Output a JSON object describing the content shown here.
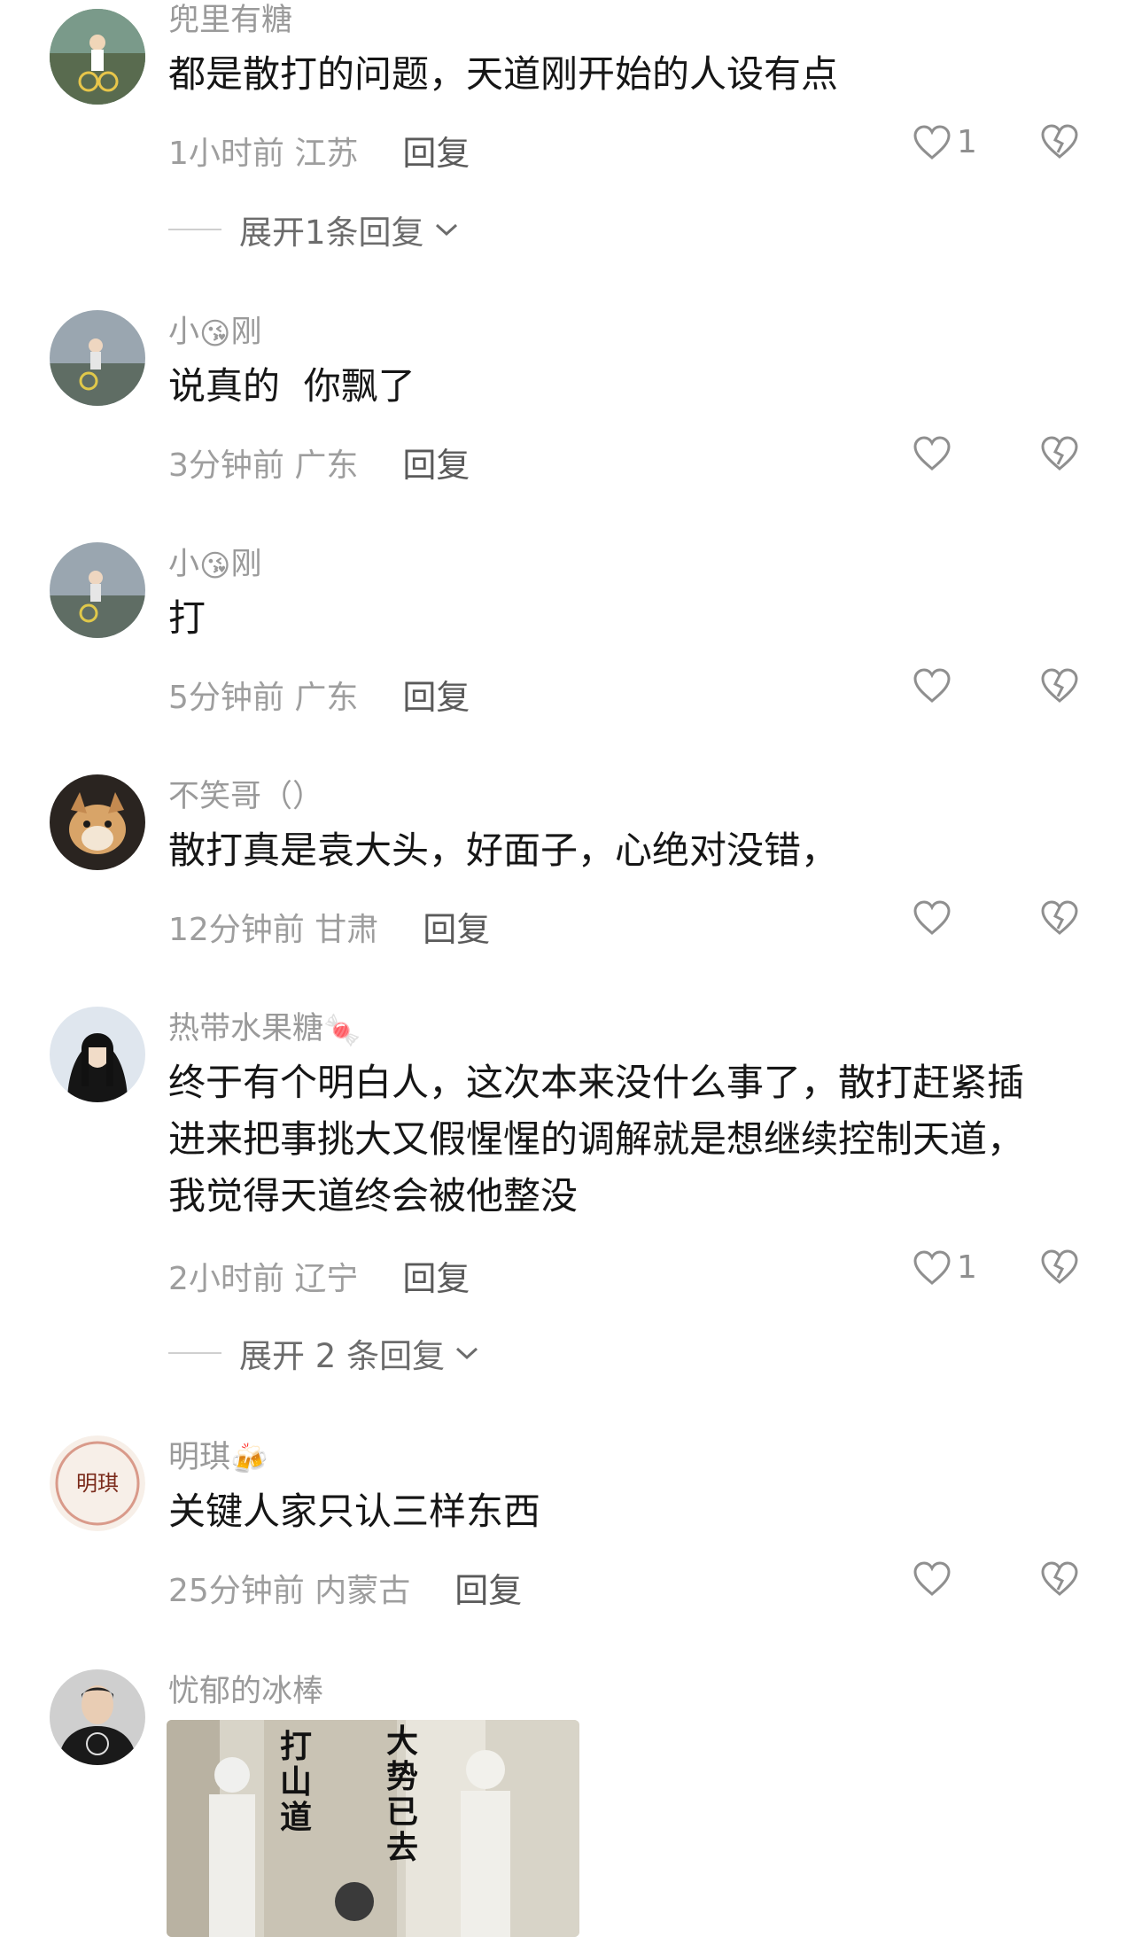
{
  "comments": [
    {
      "username": "兜里有糖",
      "text": "都是散打的问题，天道刚开始的人设有点",
      "time": "1小时前 江苏",
      "reply": "回复",
      "likes": "1",
      "expand": "展开1条回复"
    },
    {
      "username_a": "小",
      "username_b": "刚",
      "emoji": "😘",
      "text": "说真的  你飘了",
      "time": "3分钟前 广东",
      "reply": "回复",
      "likes": ""
    },
    {
      "username_a": "小",
      "username_b": "刚",
      "emoji": "😘",
      "text": "打",
      "time": "5分钟前 广东",
      "reply": "回复",
      "likes": ""
    },
    {
      "username": "不笑哥（）",
      "text": "散打真是袁大头，好面子，心绝对没错，",
      "time": "12分钟前 甘肃",
      "reply": "回复",
      "likes": ""
    },
    {
      "username": "热带水果糖",
      "emoji": "🍬",
      "text_lines": [
        "终于有个明白人，这次本来没什么事了，散打赶紧插",
        "进来把事挑大又假惺惺的调解就是想继续控制天道，",
        "我觉得天道终会被他整没"
      ],
      "time": "2小时前 辽宁",
      "reply": "回复",
      "likes": "1",
      "expand": "展开 2 条回复"
    },
    {
      "username": "明琪",
      "emoji": "🍻",
      "text": "关键人家只认三样东西",
      "time": "25分钟前 内蒙古",
      "reply": "回复",
      "likes": ""
    },
    {
      "username": "忧郁的冰棒",
      "image_text_left": "打山道",
      "image_text_right": "大势已去"
    }
  ]
}
